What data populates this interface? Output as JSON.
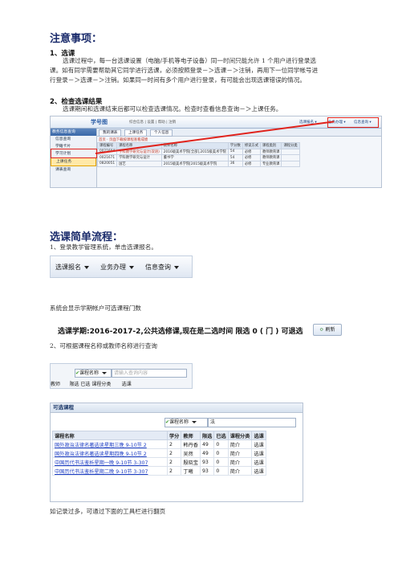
{
  "notice": {
    "title": "注意事项：",
    "s1_title": "1、选课",
    "s1_lines": [
      "选课过程中，每一台选课设置（电脑/手机等电子设备）同一时间只能允许 1 个用户进行登录选",
      "课。如有同学需要帮助其它同学进行选课，必须按照登录－＞选课－＞注销，再用下一位同学帐号进",
      "行登录－＞选课－＞注销。如果同一时间有多个用户进行登录，有可能会出现选课错误的情况。"
    ],
    "s2_title": "2、检查选课结果",
    "s2_line": "选课期间和选课结束后都可以检查选课情况。检查时查看信息查询－＞上课任务。"
  },
  "screenshot1": {
    "logo": "学号图",
    "app_title": "综合信息 | 设置 | 帮助 | 注销",
    "menu_items": [
      "选课报名 ▾",
      "业务办理 ▾",
      "信息查询 ▾"
    ],
    "left_header": "教务信息查询",
    "left_items": [
      "信息查询",
      "学籍卡片",
      "学习计划",
      "上课任务",
      "课表查询"
    ],
    "tabs": [
      "我的课表",
      "上课任务",
      "个人信息"
    ],
    "notice_text": "首页 · 页面下载按课程查看成绩",
    "columns": [
      "课程编号",
      "课程名称",
      "教师名称",
      "学分数",
      "修读方式",
      "课程类别",
      "课程分类"
    ],
    "rows": [
      [
        "0021604",
        "学科教学研究与设计(双语)",
        "2016级美术学院[全部],2015级美术学院",
        "54",
        "必修",
        "教师教育课"
      ],
      [
        "0021671",
        "学科教学研究与设计",
        "董书学",
        "54",
        "必修",
        "教师教育课"
      ],
      [
        "0820051",
        "国艺",
        "2015级美术学院[2015级美术学院",
        "36",
        "必修",
        "专业教育课"
      ]
    ]
  },
  "section2": {
    "title": "选课简单流程：",
    "step1": "1、登录教学管理系统，单击选课报名。",
    "toolbar_items": [
      "选课报名",
      "业务办理",
      "信息查询"
    ],
    "step1_note": "系统会显示学期帐户可选课程门数",
    "status_line": "选课学期:2016-2017-2,公共选修课,现在是二选时间   限选 0 ( 门 )   可退选",
    "refresh_label": "刷新",
    "step2": "2、可根据课程名称或教师名称进行查询",
    "search1": {
      "select_label": "课程名称",
      "placeholder": "请输入查询内容",
      "headers": [
        "教师",
        "限选",
        "已选",
        "课程分类",
        "选课"
      ]
    },
    "search2": {
      "header": "可选课程",
      "select_label": "课程名称",
      "query": "法",
      "columns": [
        "课程名称",
        "学分",
        "教师",
        "限选",
        "已选",
        "课程分类",
        "选课"
      ],
      "rows": [
        [
          "国外政治法律名著选读星期三晚 9-10节 2",
          "2",
          "韩丹香",
          "49",
          "0",
          "",
          "简介",
          "选课"
        ],
        [
          "国外政治法律名著选读星期四晚 9-10节 2",
          "2",
          "吴然",
          "49",
          "0",
          "",
          "简介",
          "选课"
        ],
        [
          "中国历代书法鉴析星期一晚 9-10节 3-307",
          "2",
          "殷晓宝",
          "93",
          "0",
          "",
          "简介",
          "选课"
        ],
        [
          "中国历代书法鉴析星期二晚 9-10节 3-307",
          "2",
          "丁曦",
          "93",
          "0",
          "",
          "简介",
          "选课"
        ]
      ]
    },
    "footer_note": "如记录过多，可通过下面的工具栏进行翻页"
  },
  "colors": {
    "accent": "#e0231c",
    "link": "#1f3fc4",
    "heading": "#1a2b6b"
  }
}
